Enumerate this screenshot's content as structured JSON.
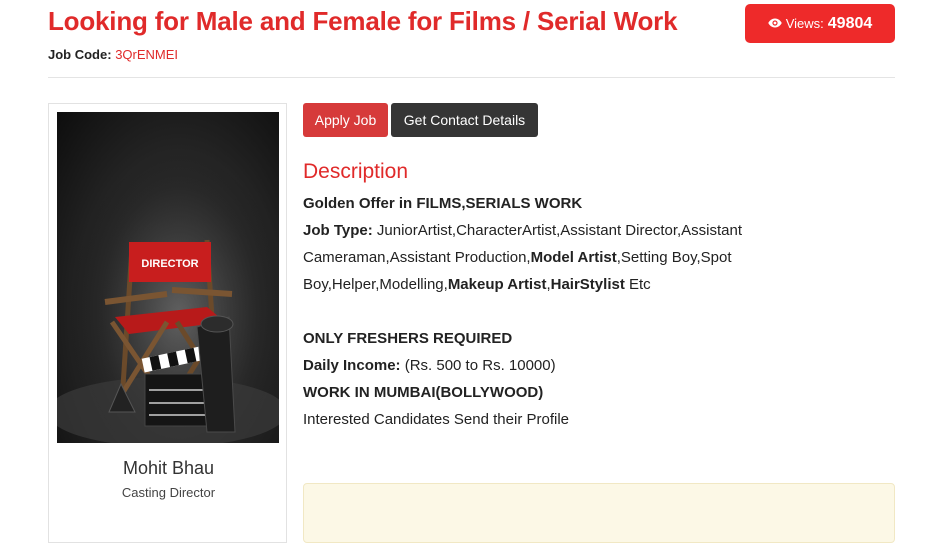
{
  "header": {
    "title": "Looking for Male and Female for Films / Serial Work",
    "job_code_label": "Job Code:",
    "job_code_value": "3QrENMEI",
    "views_label": "Views:",
    "views_count": "49804"
  },
  "profile": {
    "image_text": "DIRECTOR",
    "name": "Mohit Bhau",
    "role": "Casting Director"
  },
  "actions": {
    "apply_label": "Apply Job",
    "contact_label": "Get Contact Details"
  },
  "description": {
    "heading": "Description",
    "offer": "Golden Offer in FILMS,SERIALS WORK",
    "job_type_label": "Job Type:",
    "job_type_1": " JuniorArtist,CharacterArtist,Assistant Director,Assistant Cameraman,Assistant Production,",
    "job_type_2": "Model Artist",
    "job_type_3": ",Setting Boy,Spot Boy,Helper,Modelling,",
    "job_type_4": "Makeup Artist",
    "job_type_5": ",",
    "job_type_6": "HairStylist",
    "job_type_7": " Etc",
    "freshers": "ONLY FRESHERS REQUIRED",
    "income_label": "Daily Income:",
    "income_value": " (Rs. 500 to Rs. 10000)",
    "location": "WORK IN MUMBAI(BOLLYWOOD)",
    "closing": "Interested Candidates Send their Profile"
  },
  "colors": {
    "accent": "#e02a2a",
    "views_bg": "#ee2a2a",
    "dark_button": "#353535",
    "note_bg": "#fcf8e6"
  }
}
